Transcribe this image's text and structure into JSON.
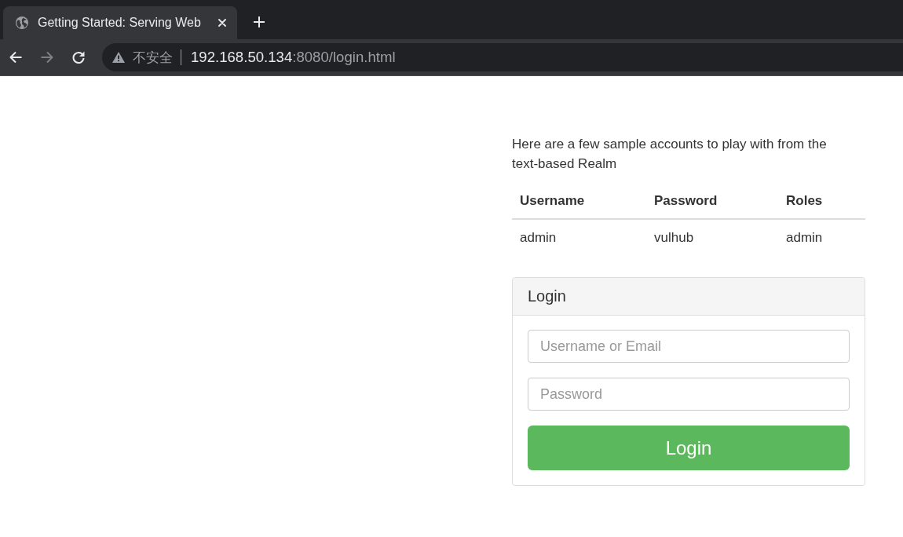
{
  "browser": {
    "tabs": [
      {
        "title": "Getting Started: Serving Web",
        "selected": true
      }
    ],
    "nav_buttons": [
      {
        "kind": "back",
        "disabled": false
      },
      {
        "kind": "forward",
        "disabled": true
      },
      {
        "kind": "reload",
        "disabled": false
      }
    ],
    "address_bar": {
      "security_label": "不安全",
      "host": "192.168.50.134",
      "path": ":8080/login.html"
    }
  },
  "intro": "Here are a few sample accounts to play with from the text-based Realm",
  "accounts_table": {
    "columns": [
      "Username",
      "Password",
      "Roles"
    ],
    "rows": [
      [
        "admin",
        "vulhub",
        "admin"
      ]
    ]
  },
  "login_panel": {
    "title": "Login",
    "fields": [
      {
        "placeholder": "Username or Email"
      },
      {
        "placeholder": "Password"
      }
    ],
    "submit": "Login"
  }
}
